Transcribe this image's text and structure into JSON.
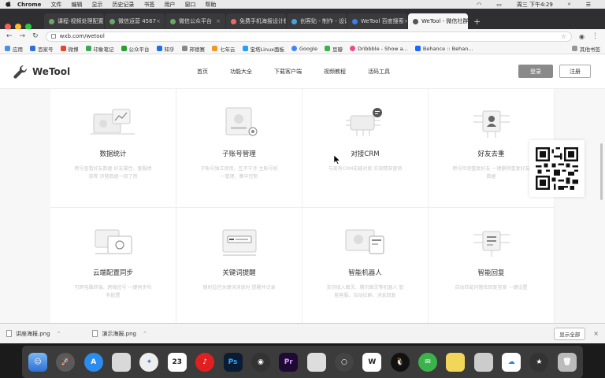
{
  "menubar": {
    "app": "Chrome",
    "items": [
      "文件",
      "编辑",
      "显示",
      "历史记录",
      "书签",
      "用户",
      "窗口",
      "帮助"
    ],
    "clock": "周三 下午4:29"
  },
  "tabs": [
    {
      "label": "课程-视频处理配置",
      "active": false
    },
    {
      "label": "微信运营 4567",
      "active": false
    },
    {
      "label": "微信公众平台",
      "active": false
    },
    {
      "label": "免费手机海报设计模板",
      "active": false
    },
    {
      "label": "创客贴 - 制作 - 设计",
      "active": false
    },
    {
      "label": "WeTool 百度搜索",
      "active": false
    },
    {
      "label": "WeTool - 微信社群管",
      "active": true
    }
  ],
  "address": {
    "url": "wxb.com/wetool"
  },
  "bookmarks": [
    "应用",
    "百家号",
    "微博",
    "印象笔记",
    "公众平台",
    "知乎",
    "邦德赛",
    "七年云",
    "宝塔Linux面板",
    "Google",
    "豆瓣",
    "Dribbble - Show a...",
    "Behance :: Behan..."
  ],
  "bookmarks_other": "其他书签",
  "site": {
    "logo": "WeTool",
    "nav": [
      "首页",
      "功能大全",
      "下载客户端",
      "视频教程",
      "活码工具"
    ],
    "login": "登录",
    "register": "注册"
  },
  "features": [
    {
      "title": "数据统计",
      "desc": "跨号查看好友数据 好友属性、客服绩效等 涉营数据一目了然"
    },
    {
      "title": "子账号管理",
      "desc": "子账号独立使用，互不干涉 主账号统一管理，集中控制"
    },
    {
      "title": "对接CRM",
      "desc": "与现有CRM无缝对接 实现精准营销"
    },
    {
      "title": "好友去重",
      "desc": "跨号检测重复好友 一键删除重复好友数据"
    },
    {
      "title": "云端配置同步",
      "desc": "可跨电脑终端、跨微信号 一键同步所有配置"
    },
    {
      "title": "关键词提醒",
      "desc": "随时监控关键词消息时 提醒并记录"
    },
    {
      "title": "智能机器人",
      "desc": "支持接入图灵、腾讯图灵等机器人 智能客服、自动拉群、消息回复"
    },
    {
      "title": "智能回复",
      "desc": "自动匹配问题库回复答案 一键设置"
    }
  ],
  "downloads": [
    {
      "name": "讲座海报.png"
    },
    {
      "name": "演示海报.png"
    }
  ],
  "downloads_showall": "显示全部",
  "dock_icons": [
    "finder-icon",
    "launchpad-icon",
    "appstore-icon",
    "preview-icon",
    "safari-icon",
    "calendar-icon",
    "netease-music-icon",
    "photoshop-icon",
    "camera-icon",
    "premiere-icon",
    "presentation-icon",
    "screenrecorder-icon",
    "wps-icon",
    "qq-icon",
    "wechat-icon",
    "notes-icon",
    "keynote-icon",
    "baidu-netdisk-icon",
    "wunderlist-icon",
    "trash-icon"
  ],
  "colors": {
    "login_bg": "#8a8a8a",
    "accent": "#555555"
  }
}
